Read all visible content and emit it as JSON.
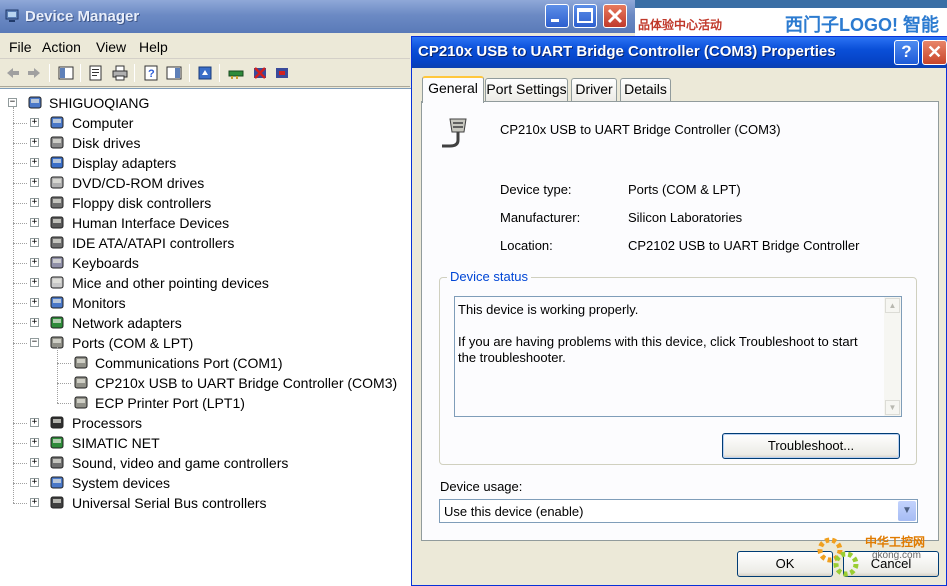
{
  "device_manager": {
    "title": "Device Manager",
    "menu": [
      "File",
      "Action",
      "View",
      "Help"
    ],
    "toolbar_icons": [
      "back-icon",
      "forward-icon",
      "show-hide-tree-icon",
      "properties-icon",
      "print-icon",
      "help-icon",
      "show-hide-icon",
      "update-driver-icon",
      "scan-hardware-icon",
      "disable-icon",
      "uninstall-icon"
    ],
    "tree": {
      "root": "SHIGUOQIANG",
      "items": [
        {
          "label": "Computer",
          "icon": "computer-icon",
          "expanded": false
        },
        {
          "label": "Disk drives",
          "icon": "disk-drive-icon",
          "expanded": false
        },
        {
          "label": "Display adapters",
          "icon": "display-adapter-icon",
          "expanded": false
        },
        {
          "label": "DVD/CD-ROM drives",
          "icon": "dvd-icon",
          "expanded": false
        },
        {
          "label": "Floppy disk controllers",
          "icon": "floppy-controller-icon",
          "expanded": false
        },
        {
          "label": "Human Interface Devices",
          "icon": "hid-icon",
          "expanded": false
        },
        {
          "label": "IDE ATA/ATAPI controllers",
          "icon": "ide-controller-icon",
          "expanded": false
        },
        {
          "label": "Keyboards",
          "icon": "keyboard-icon",
          "expanded": false
        },
        {
          "label": "Mice and other pointing devices",
          "icon": "mouse-icon",
          "expanded": false
        },
        {
          "label": "Monitors",
          "icon": "monitor-icon",
          "expanded": false
        },
        {
          "label": "Network adapters",
          "icon": "network-adapter-icon",
          "expanded": false
        },
        {
          "label": "Ports (COM & LPT)",
          "icon": "port-icon",
          "expanded": true,
          "children": [
            "Communications Port (COM1)",
            "CP210x USB to UART Bridge Controller (COM3)",
            "ECP Printer Port (LPT1)"
          ]
        },
        {
          "label": "Processors",
          "icon": "processor-icon",
          "expanded": false
        },
        {
          "label": "SIMATIC NET",
          "icon": "simatic-net-icon",
          "expanded": false
        },
        {
          "label": "Sound, video and game controllers",
          "icon": "sound-icon",
          "expanded": false
        },
        {
          "label": "System devices",
          "icon": "system-device-icon",
          "expanded": false
        },
        {
          "label": "Universal Serial Bus controllers",
          "icon": "usb-icon",
          "expanded": false
        }
      ]
    }
  },
  "background_window": {
    "text_left": "品体验中心活动",
    "text_right": "西门子LOGO! 智能"
  },
  "dialog": {
    "title": "CP210x USB to UART Bridge Controller (COM3) Properties",
    "help_label": "?",
    "close_label": "✕",
    "tabs": [
      "General",
      "Port Settings",
      "Driver",
      "Details"
    ],
    "active_tab": "General",
    "device_name": "CP210x USB to UART Bridge Controller (COM3)",
    "props": {
      "type_label": "Device type:",
      "type_value": "Ports (COM & LPT)",
      "manufacturer_label": "Manufacturer:",
      "manufacturer_value": "Silicon Laboratories",
      "location_label": "Location:",
      "location_value": "CP2102 USB to UART Bridge Controller"
    },
    "status": {
      "legend": "Device status",
      "line1": "This device is working properly.",
      "line2": "If you are having problems with this device, click Troubleshoot to start the troubleshooter.",
      "troubleshoot_label": "Troubleshoot..."
    },
    "usage": {
      "label": "Device usage:",
      "value": "Use this device (enable)"
    },
    "ok_label": "OK",
    "cancel_label": "Cancel"
  },
  "watermark": {
    "text1": "中华工控网",
    "text2": "gkong.com"
  }
}
